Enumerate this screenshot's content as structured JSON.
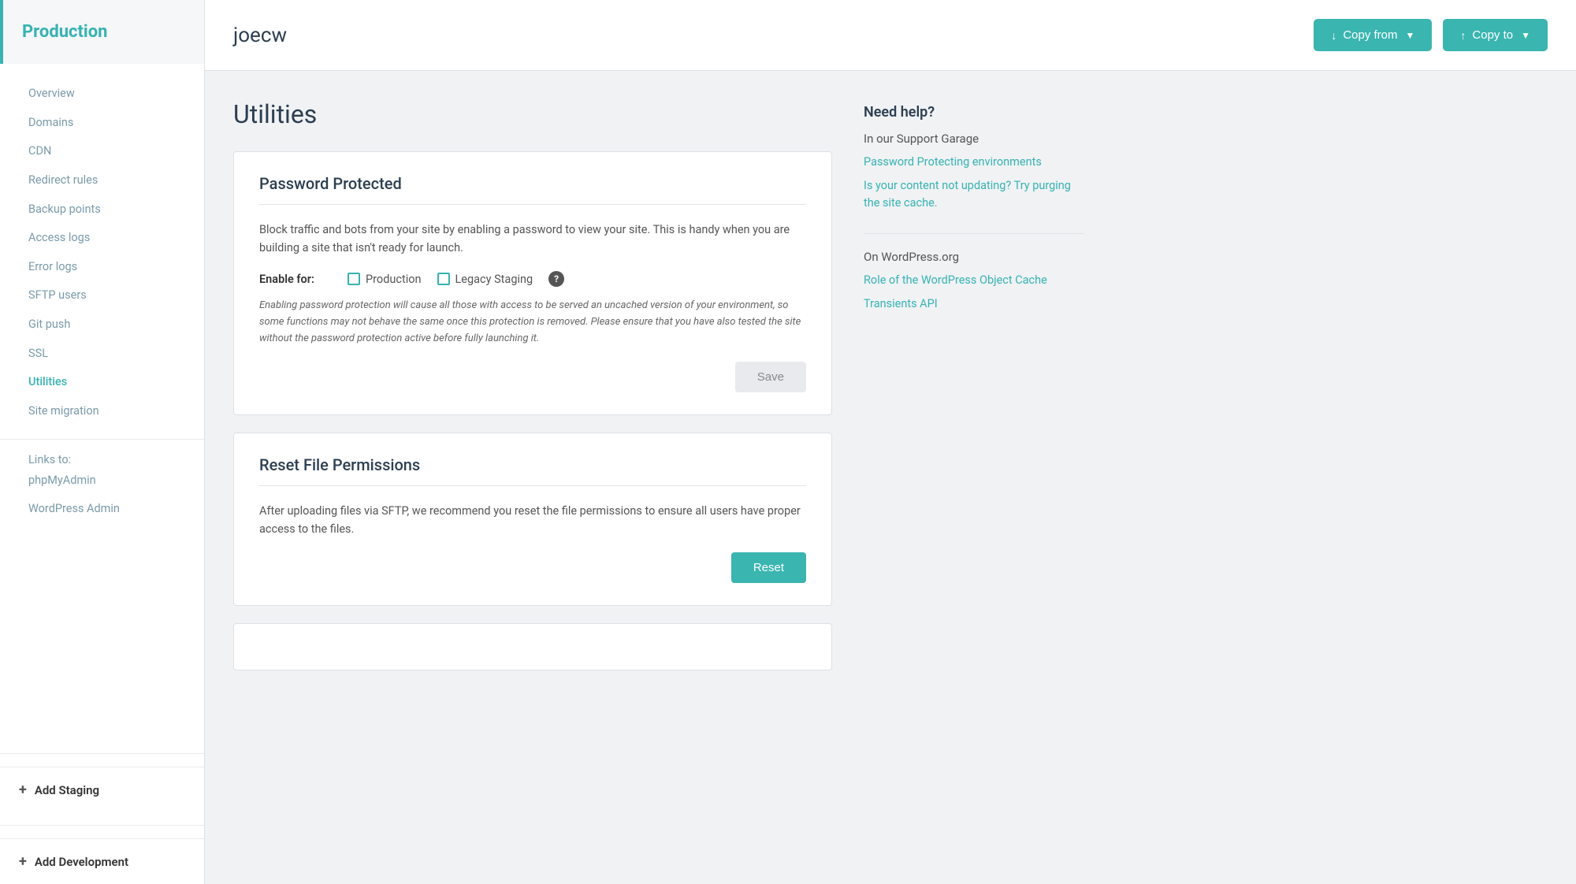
{
  "sidebar": {
    "env_label": "Production",
    "nav_items": [
      {
        "label": "Overview",
        "href": "#",
        "active": false
      },
      {
        "label": "Domains",
        "href": "#",
        "active": false
      },
      {
        "label": "CDN",
        "href": "#",
        "active": false
      },
      {
        "label": "Redirect rules",
        "href": "#",
        "active": false
      },
      {
        "label": "Backup points",
        "href": "#",
        "active": false
      },
      {
        "label": "Access logs",
        "href": "#",
        "active": false
      },
      {
        "label": "Error logs",
        "href": "#",
        "active": false
      },
      {
        "label": "SFTP users",
        "href": "#",
        "active": false
      },
      {
        "label": "Git push",
        "href": "#",
        "active": false
      },
      {
        "label": "SSL",
        "href": "#",
        "active": false
      },
      {
        "label": "Utilities",
        "href": "#",
        "active": true
      },
      {
        "label": "Site migration",
        "href": "#",
        "active": false
      }
    ],
    "links_label": "Links to:",
    "external_links": [
      {
        "label": "phpMyAdmin",
        "href": "#"
      },
      {
        "label": "WordPress Admin",
        "href": "#"
      }
    ],
    "add_staging": "Add Staging",
    "add_development": "Add Development"
  },
  "topbar": {
    "title": "joecw",
    "copy_from_label": "Copy from",
    "copy_to_label": "Copy to"
  },
  "main": {
    "page_title": "Utilities",
    "password_protected": {
      "title": "Password Protected",
      "description": "Block traffic and bots from your site by enabling a password to view your site. This is handy when you are building a site that isn't ready for launch.",
      "enable_for_label": "Enable for:",
      "production_label": "Production",
      "legacy_staging_label": "Legacy Staging",
      "warning": "Enabling password protection will cause all those with access to be served an uncached version of your environment, so some functions may not behave the same once this protection is removed. Please ensure that you have also tested the site without the password protection active before fully launching it.",
      "save_label": "Save"
    },
    "reset_file_permissions": {
      "title": "Reset File Permissions",
      "description": "After uploading files via SFTP, we recommend you reset the file permissions to ensure all users have proper access to the files.",
      "reset_label": "Reset"
    }
  },
  "sidebar_right": {
    "need_help_title": "Need help?",
    "support_subtitle": "In our Support Garage",
    "support_links": [
      {
        "label": "Password Protecting environments",
        "href": "#"
      },
      {
        "label": "Is your content not updating? Try purging the site cache.",
        "href": "#"
      }
    ],
    "wordpress_subtitle": "On WordPress.org",
    "wordpress_links": [
      {
        "label": "Role of the WordPress Object Cache",
        "href": "#"
      },
      {
        "label": "Transients API",
        "href": "#"
      }
    ]
  }
}
